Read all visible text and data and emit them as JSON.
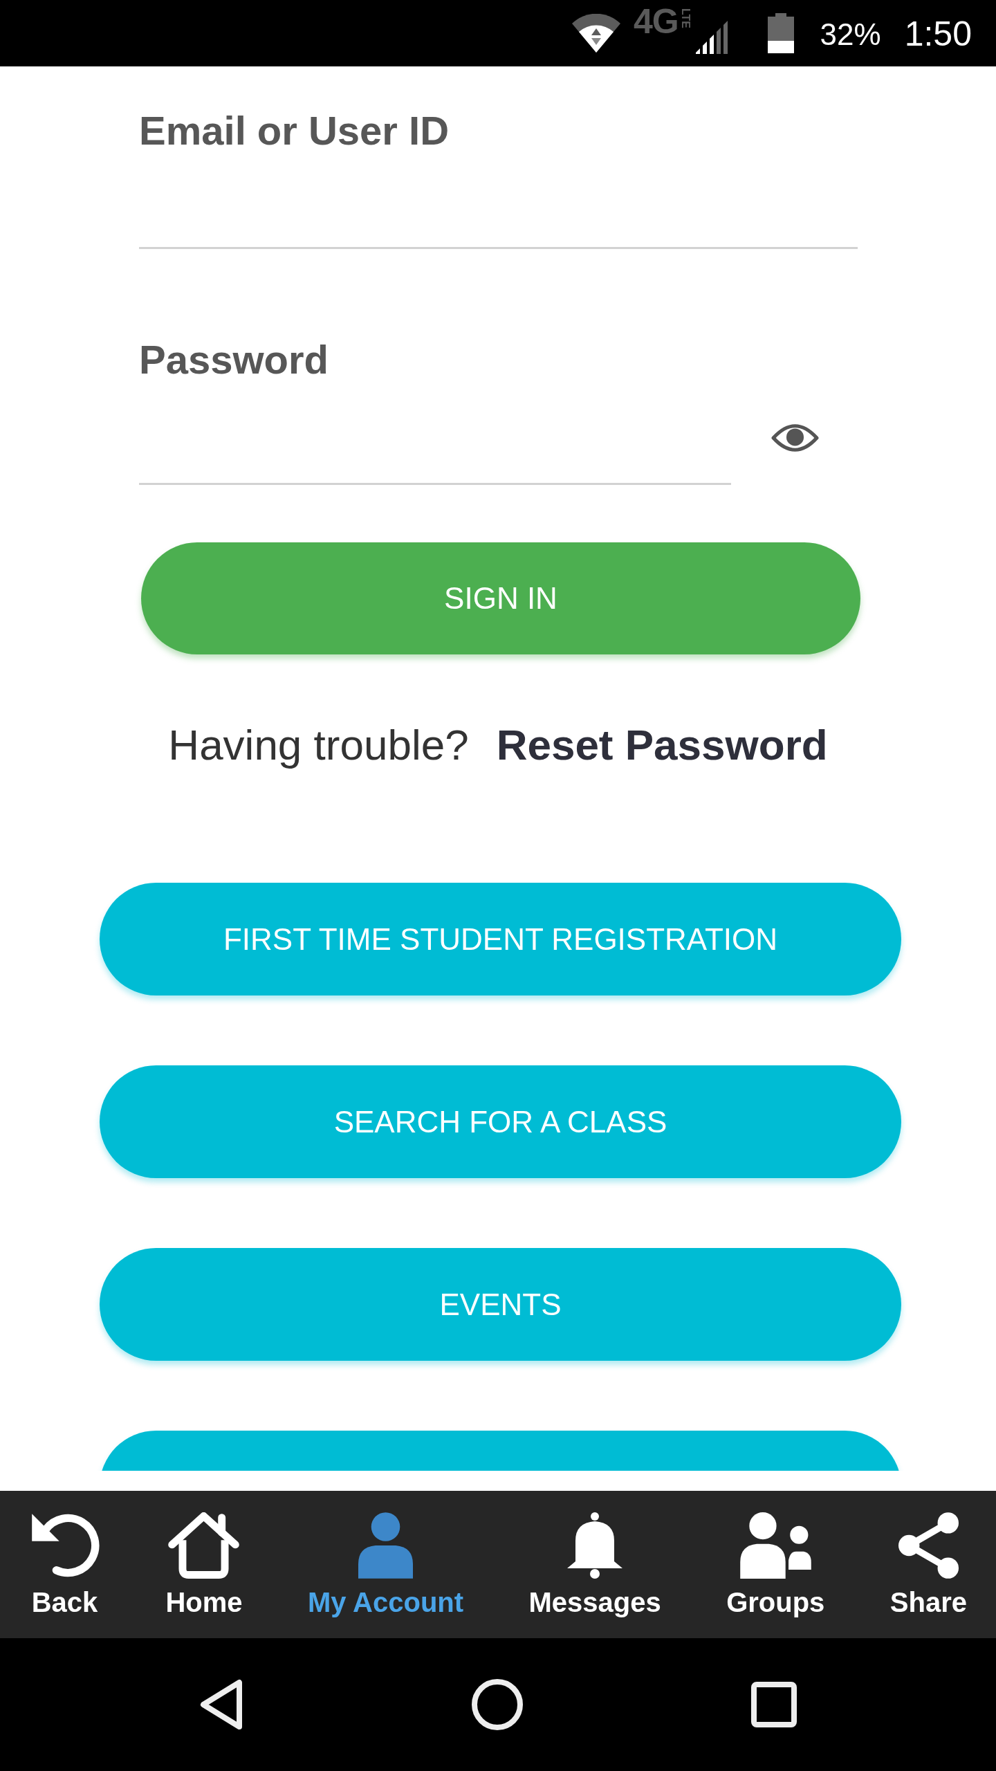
{
  "status_bar": {
    "network": "4G",
    "network_sub": "LTE",
    "battery": "32%",
    "time": "1:50"
  },
  "form": {
    "fields": [
      {
        "kind": "text",
        "label": "Email or User ID"
      },
      {
        "kind": "password",
        "label": "Password"
      }
    ],
    "submit": "SIGN IN",
    "help_text": "Having trouble?",
    "help_link": "Reset Password"
  },
  "menu_buttons": [
    {
      "kind": "full",
      "label": "FIRST TIME STUDENT REGISTRATION"
    },
    {
      "kind": "full",
      "label": "SEARCH FOR A CLASS"
    },
    {
      "kind": "full",
      "label": "EVENTS"
    },
    {
      "kind": "clipped"
    }
  ],
  "tab_bar": [
    {
      "label": "Back",
      "selected": false
    },
    {
      "label": "Home",
      "selected": false
    },
    {
      "label": "My Account",
      "selected": true
    },
    {
      "label": "Messages",
      "selected": false
    },
    {
      "label": "Groups",
      "selected": false
    },
    {
      "label": "Share",
      "selected": false
    }
  ]
}
